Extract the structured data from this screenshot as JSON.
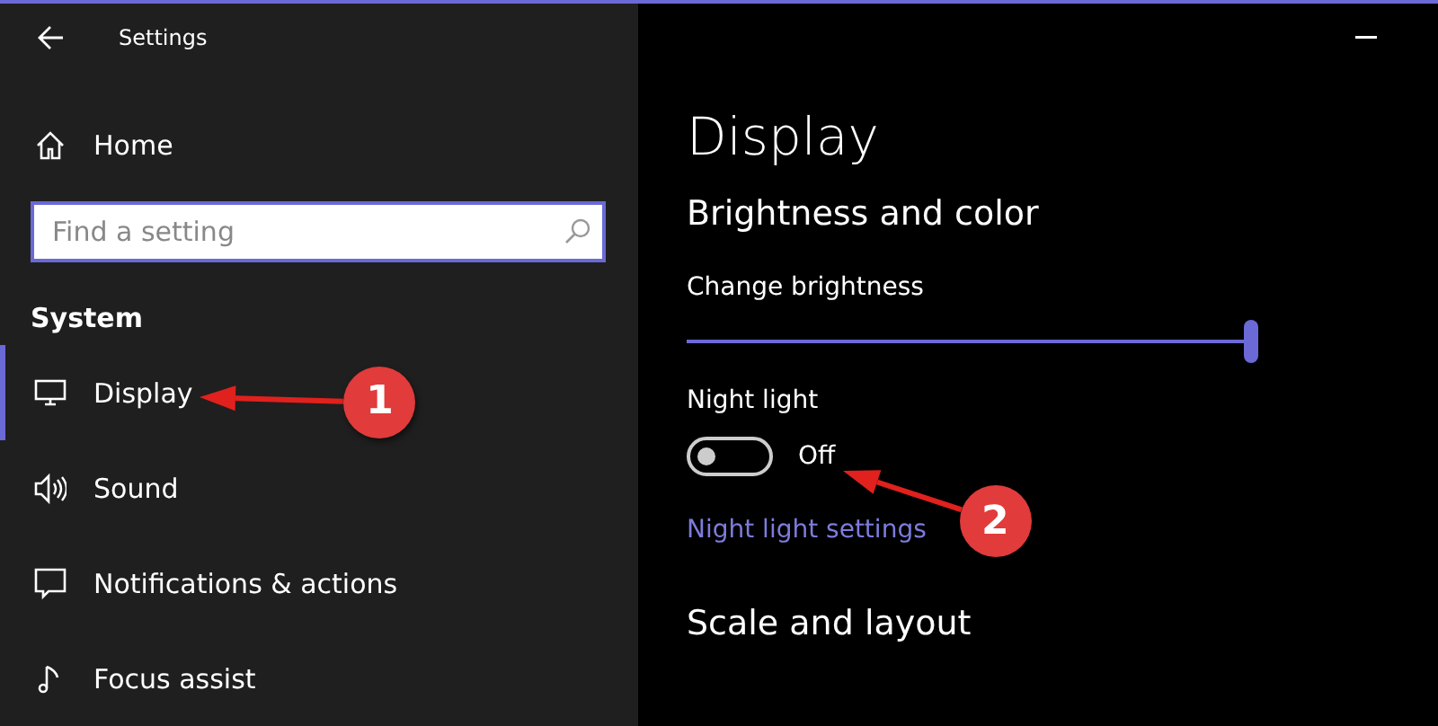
{
  "window": {
    "title": "Settings"
  },
  "sidebar": {
    "home": "Home",
    "search": {
      "placeholder": "Find a setting"
    },
    "section": "System",
    "items": [
      {
        "label": "Display",
        "selected": true,
        "callout": "1"
      },
      {
        "label": "Sound",
        "selected": false
      },
      {
        "label": "Notifications & actions",
        "selected": false
      },
      {
        "label": "Focus assist",
        "selected": false
      }
    ]
  },
  "main": {
    "title": "Display",
    "section": "Brightness and color",
    "brightness": {
      "label": "Change brightness",
      "level": 1.0
    },
    "night_light": {
      "label": "Night light",
      "on": false,
      "state": "Off",
      "callout": "2"
    },
    "link": "Night light settings",
    "next_section": "Scale and layout"
  }
}
